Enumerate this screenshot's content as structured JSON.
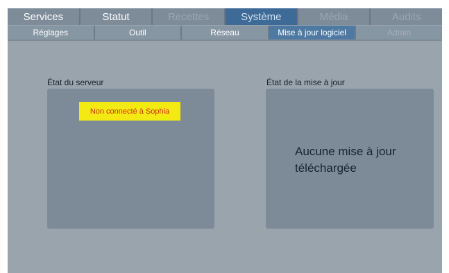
{
  "main_tabs": [
    {
      "label": "Services",
      "state": "normal"
    },
    {
      "label": "Statut",
      "state": "normal"
    },
    {
      "label": "Recettes",
      "state": "disabled"
    },
    {
      "label": "Système",
      "state": "active"
    },
    {
      "label": "Média",
      "state": "disabled"
    },
    {
      "label": "Audits",
      "state": "disabled"
    }
  ],
  "sub_tabs": [
    {
      "label": "Réglages",
      "state": "normal"
    },
    {
      "label": "Outil",
      "state": "normal"
    },
    {
      "label": "Réseau",
      "state": "normal"
    },
    {
      "label": "Mise à jour logiciel",
      "state": "active"
    },
    {
      "label": "Admin",
      "state": "disabled"
    }
  ],
  "server_panel": {
    "title": "État du serveur",
    "status_badge": "Non connecté à Sophia"
  },
  "update_panel": {
    "title": "État de la mise à jour",
    "message": "Aucune mise à jour téléchargée"
  },
  "colors": {
    "background": "#9aa4ad",
    "panel": "#7d8b99",
    "active_tab": "#3e6a97",
    "badge_bg": "#f2ea12",
    "badge_text": "#d62a1e"
  }
}
